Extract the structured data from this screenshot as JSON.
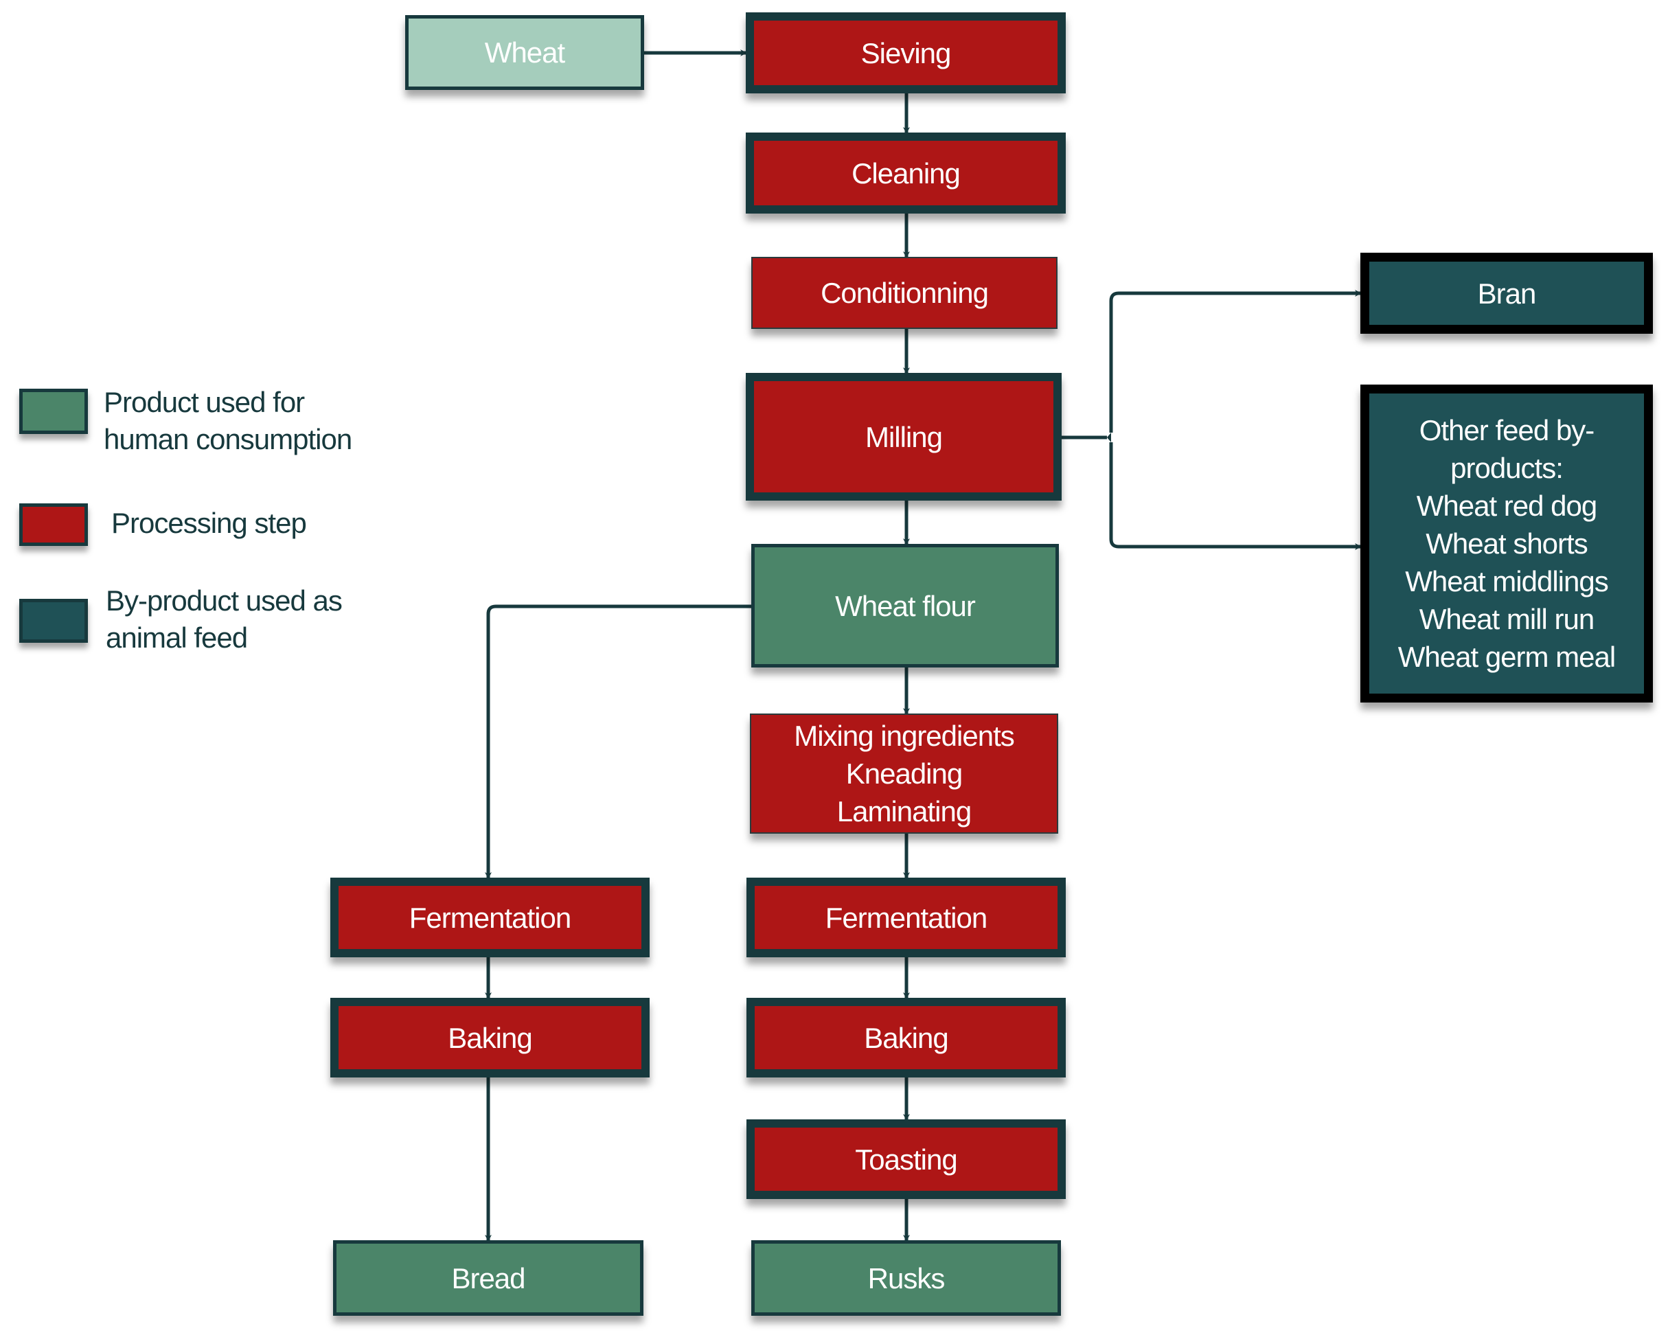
{
  "colors": {
    "processing_step": "#ae1616",
    "human_product": "#4b8569",
    "raw_material": "#a5cdbc",
    "animal_feed": "#1f5156",
    "connector": "#17393d"
  },
  "legend": [
    {
      "label": "Product used for\nhuman consumption",
      "category": "human_product"
    },
    {
      "label": "Processing step",
      "category": "processing_step"
    },
    {
      "label": "By-product used as\nanimal feed",
      "category": "animal_feed"
    }
  ],
  "nodes": {
    "wheat": "Wheat",
    "sieving": "Sieving",
    "cleaning": "Cleaning",
    "conditioning": "Conditionning",
    "milling": "Milling",
    "wheat_flour": "Wheat flour",
    "mixing": "Mixing ingredients\nKneading\nLaminating",
    "fermentation_bread": "Fermentation",
    "baking_bread": "Baking",
    "bread": "Bread",
    "fermentation_rusks": "Fermentation",
    "baking_rusks": "Baking",
    "toasting": "Toasting",
    "rusks": "Rusks",
    "bran": "Bran",
    "other_feed": "Other feed by-\nproducts:\nWheat red dog\nWheat shorts\nWheat middlings\nWheat mill run\nWheat germ meal"
  },
  "edges": [
    [
      "wheat",
      "sieving"
    ],
    [
      "sieving",
      "cleaning"
    ],
    [
      "cleaning",
      "conditioning"
    ],
    [
      "conditioning",
      "milling"
    ],
    [
      "milling",
      "wheat_flour"
    ],
    [
      "milling",
      "bran"
    ],
    [
      "milling",
      "other_feed"
    ],
    [
      "wheat_flour",
      "mixing"
    ],
    [
      "wheat_flour",
      "fermentation_bread"
    ],
    [
      "fermentation_bread",
      "baking_bread"
    ],
    [
      "baking_bread",
      "bread"
    ],
    [
      "mixing",
      "fermentation_rusks"
    ],
    [
      "fermentation_rusks",
      "baking_rusks"
    ],
    [
      "baking_rusks",
      "toasting"
    ],
    [
      "toasting",
      "rusks"
    ]
  ]
}
